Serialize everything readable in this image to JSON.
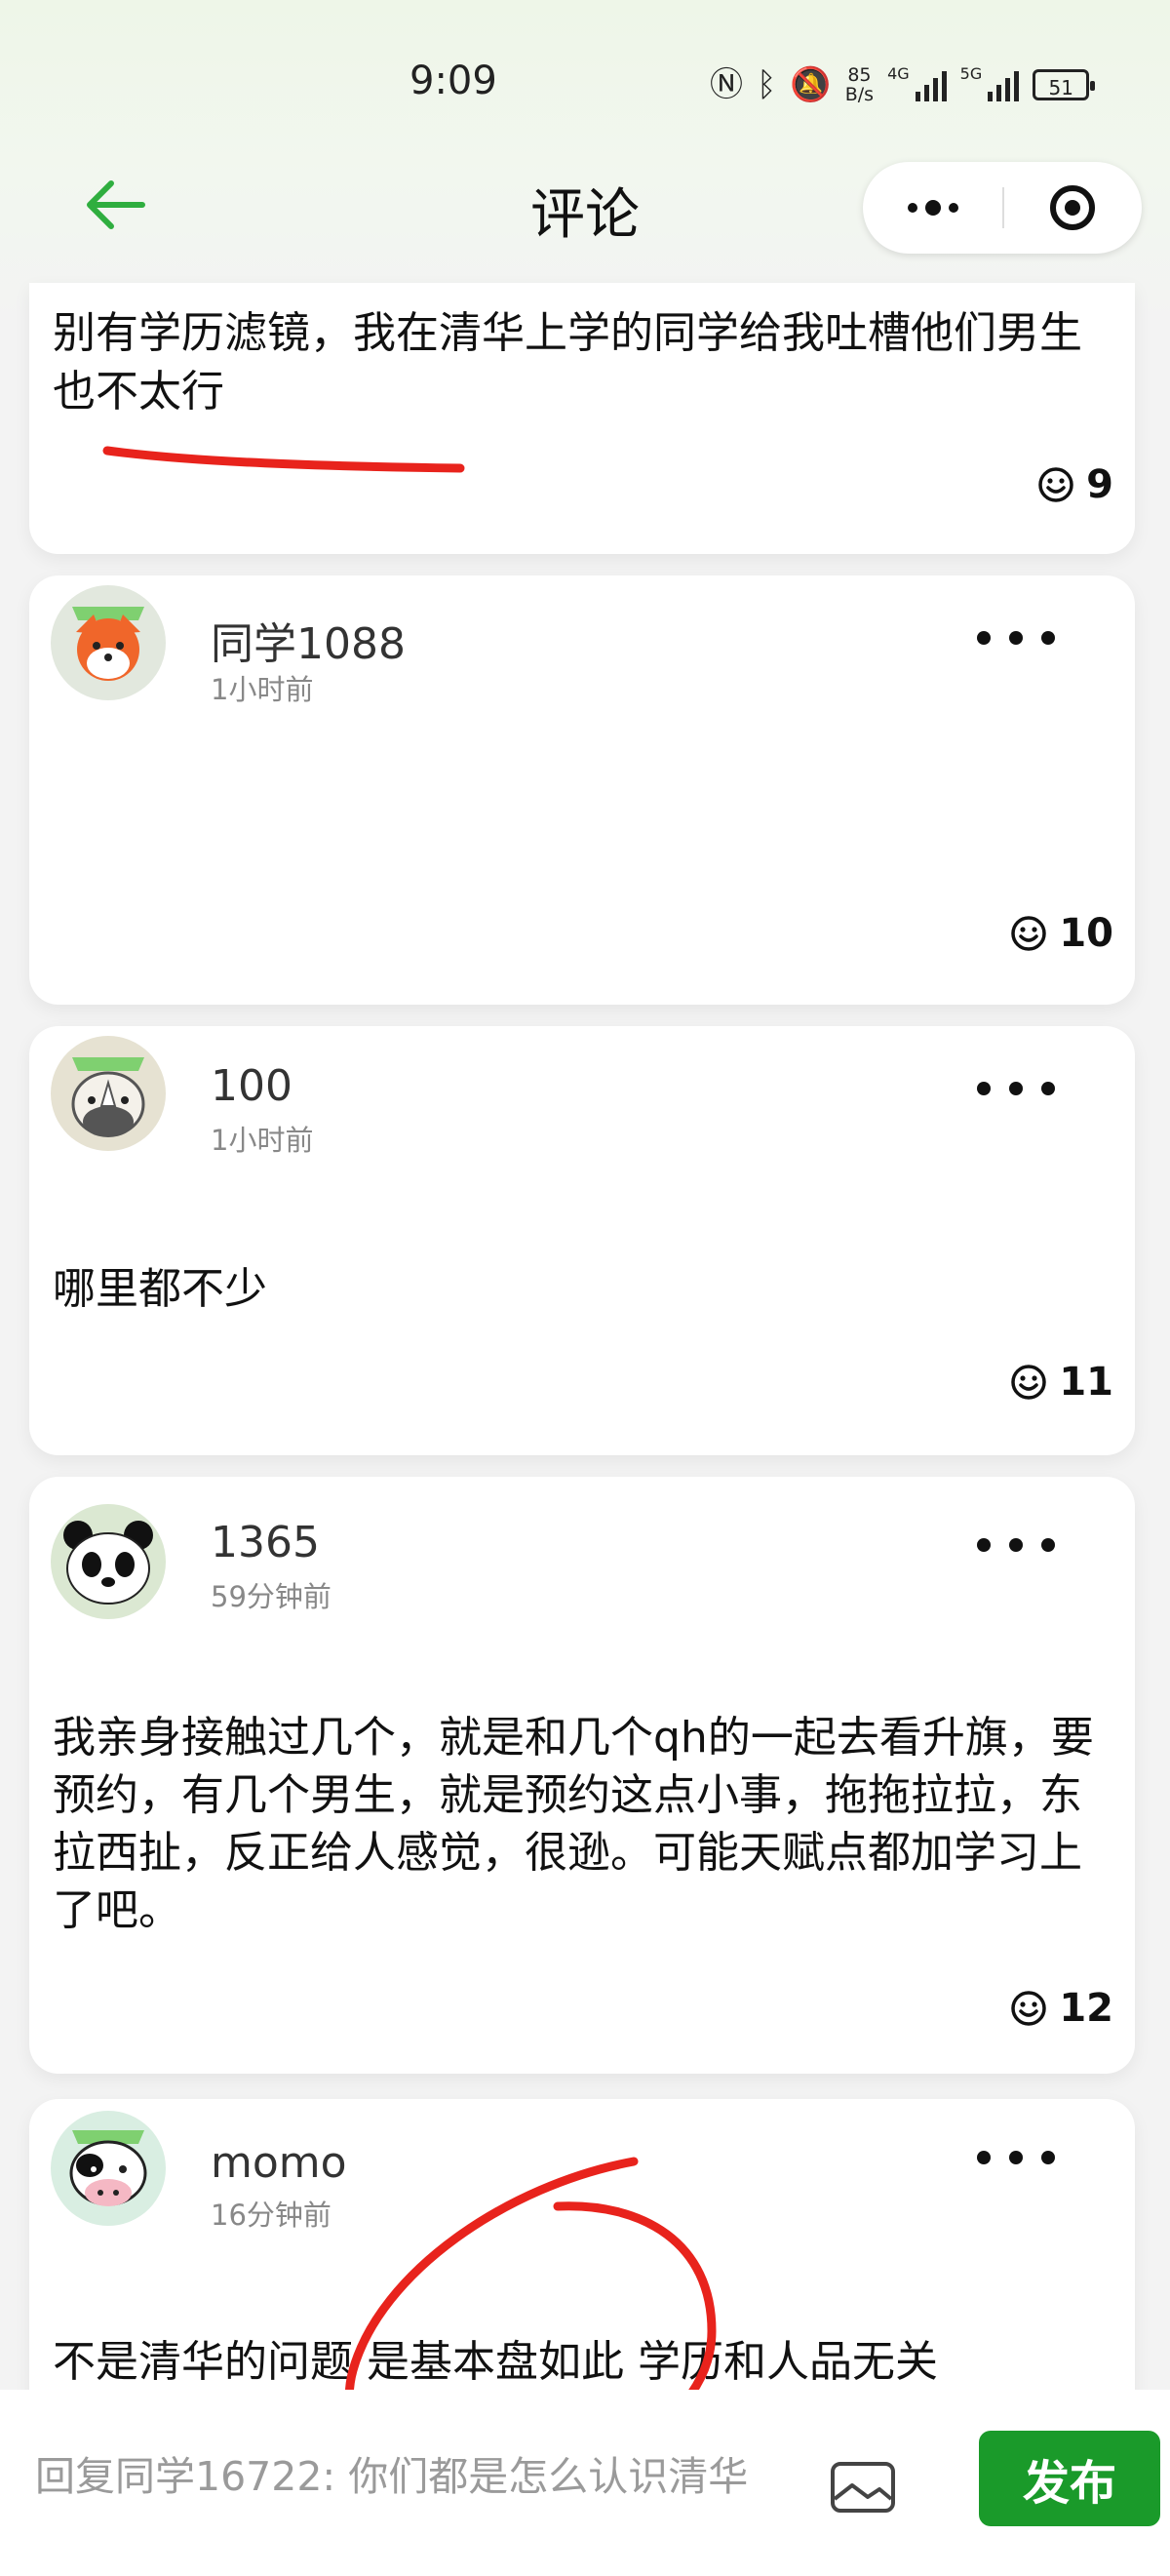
{
  "status_bar": {
    "time": "9:09",
    "net_speed_value": "85",
    "net_speed_unit": "B/s",
    "sig1": "4G",
    "sig2": "5G",
    "battery": "51"
  },
  "nav": {
    "title": "评论"
  },
  "comments": [
    {
      "content": "别有学历滤镜，我在清华上学的同学给我吐槽他们男生也不太行",
      "likes": "9"
    },
    {
      "username": "同学1088",
      "time": "1小时前",
      "content": "",
      "likes": "10"
    },
    {
      "username": "100",
      "time": "1小时前",
      "content": "哪里都不少",
      "likes": "11"
    },
    {
      "username": "1365",
      "time": "59分钟前",
      "content": "我亲身接触过几个，就是和几个qh的一起去看升旗，要预约，有几个男生，就是预约这点小事，拖拖拉拉，东拉西扯，反正给人感觉，很逊。可能天赋点都加学习上了吧。",
      "likes": "12"
    },
    {
      "username": "momo",
      "time": "16分钟前",
      "content": "不是清华的问题 是基本盘如此 学历和人品无关"
    }
  ],
  "reply": {
    "placeholder": "回复同学16722: 你们都是怎么认识清华",
    "publish": "发布"
  },
  "colors": {
    "accent": "#1a9a2a",
    "annotation": "#e8231c"
  }
}
